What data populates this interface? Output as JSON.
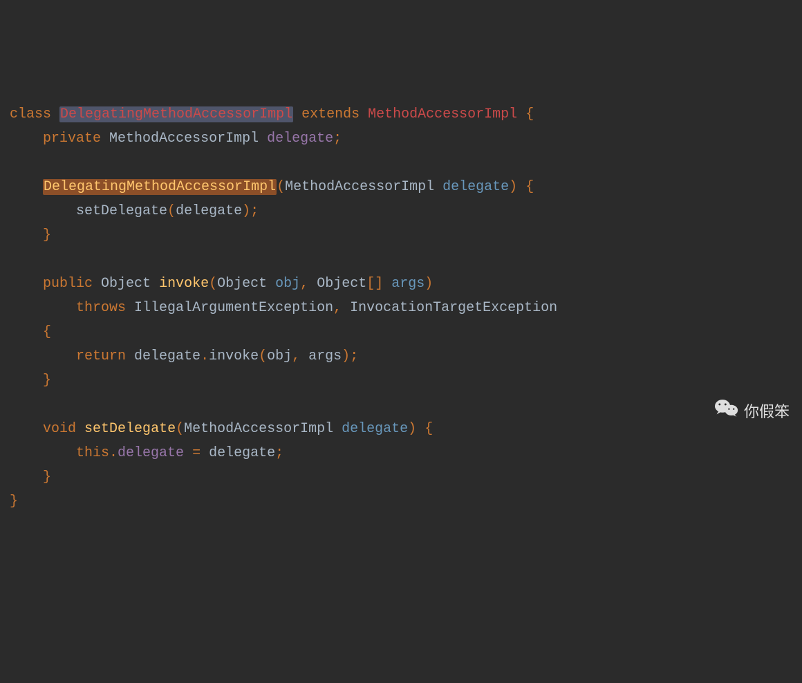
{
  "code": {
    "kw_class": "class",
    "classname": "DelegatingMethodAccessorImpl",
    "kw_extends": "extends",
    "superclass": "MethodAccessorImpl",
    "kw_private": "private",
    "type_mai": "MethodAccessorImpl",
    "field_delegate": "delegate",
    "ctor_name": "DelegatingMethodAccessorImpl",
    "param_delegate": "delegate",
    "call_setDelegate": "setDelegate",
    "kw_public": "public",
    "type_object": "Object",
    "method_invoke": "invoke",
    "param_obj": "obj",
    "param_args": "args",
    "kw_throws": "throws",
    "exc_illegalarg": "IllegalArgumentException",
    "exc_invtarget": "InvocationTargetException",
    "kw_return": "return",
    "kw_void": "void",
    "method_setDelegate": "setDelegate",
    "kw_this": "this"
  },
  "punct": {
    "semi": ";",
    "lbrace": "{",
    "rbrace": "}",
    "lparen": "(",
    "rparen": ")",
    "comma": ",",
    "dot": ".",
    "eq": "=",
    "brackets": "[]"
  },
  "watermark": {
    "text": "你假笨"
  }
}
